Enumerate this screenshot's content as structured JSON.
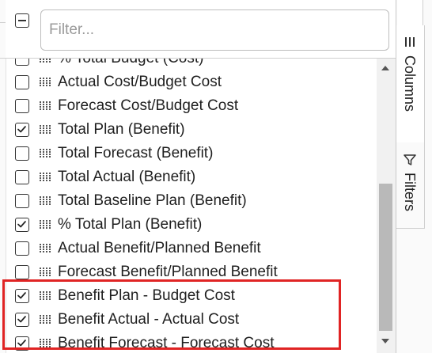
{
  "filter": {
    "placeholder": "Filter..."
  },
  "sidebar": {
    "tabs": [
      {
        "label": "Columns",
        "icon": "columns-icon"
      },
      {
        "label": "Filters",
        "icon": "filter-icon"
      }
    ]
  },
  "columns": [
    {
      "label": "% Total Budget (Cost)",
      "checked": false
    },
    {
      "label": "Actual Cost/Budget Cost",
      "checked": false
    },
    {
      "label": "Forecast Cost/Budget Cost",
      "checked": false
    },
    {
      "label": "Total Plan (Benefit)",
      "checked": true
    },
    {
      "label": "Total Forecast (Benefit)",
      "checked": false
    },
    {
      "label": "Total Actual (Benefit)",
      "checked": false
    },
    {
      "label": "Total Baseline Plan (Benefit)",
      "checked": false
    },
    {
      "label": "% Total Plan (Benefit)",
      "checked": true
    },
    {
      "label": "Actual Benefit/Planned Benefit",
      "checked": false
    },
    {
      "label": "Forecast Benefit/Planned Benefit",
      "checked": false
    },
    {
      "label": "Benefit Plan - Budget Cost",
      "checked": true
    },
    {
      "label": "Benefit Actual - Actual Cost",
      "checked": true
    },
    {
      "label": "Benefit Forecast - Forecast Cost",
      "checked": true
    }
  ],
  "colors": {
    "highlight": "#e02424",
    "scroll_thumb": "#b9b9b9"
  }
}
